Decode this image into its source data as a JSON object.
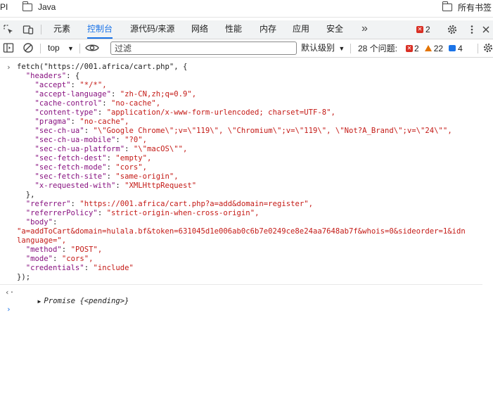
{
  "bookmarks": {
    "left_item": "Java",
    "partial_left": "PI",
    "right_item": "所有书签"
  },
  "tabs": {
    "items": [
      "元素",
      "控制台",
      "源代码/来源",
      "网络",
      "性能",
      "内存",
      "应用",
      "安全"
    ],
    "more": "»",
    "error_count": "2"
  },
  "toolbar": {
    "context": "top",
    "filter_placeholder": "过滤",
    "level": "默认级别",
    "issues_label": "28 个问题:",
    "issue_errors": "2",
    "issue_warnings": "22",
    "issue_info": "4"
  },
  "console": {
    "lines": [
      {
        "type": "call",
        "text": "fetch(\"https://001.africa/cart.php\", {"
      },
      {
        "indent": 1,
        "key": "\"headers\"",
        "rest": ": {"
      },
      {
        "indent": 2,
        "key": "\"accept\"",
        "value": "\"*/*\","
      },
      {
        "indent": 2,
        "key": "\"accept-language\"",
        "value": "\"zh-CN,zh;q=0.9\","
      },
      {
        "indent": 2,
        "key": "\"cache-control\"",
        "value": "\"no-cache\","
      },
      {
        "indent": 2,
        "key": "\"content-type\"",
        "value": "\"application/x-www-form-urlencoded; charset=UTF-8\","
      },
      {
        "indent": 2,
        "key": "\"pragma\"",
        "value": "\"no-cache\","
      },
      {
        "indent": 2,
        "key": "\"sec-ch-ua\"",
        "value": "\"\\\"Google Chrome\\\";v=\\\"119\\\", \\\"Chromium\\\";v=\\\"119\\\", \\\"Not?A_Brand\\\";v=\\\"24\\\"\","
      },
      {
        "indent": 2,
        "key": "\"sec-ch-ua-mobile\"",
        "value": "\"?0\","
      },
      {
        "indent": 2,
        "key": "\"sec-ch-ua-platform\"",
        "value": "\"\\\"macOS\\\"\","
      },
      {
        "indent": 2,
        "key": "\"sec-fetch-dest\"",
        "value": "\"empty\","
      },
      {
        "indent": 2,
        "key": "\"sec-fetch-mode\"",
        "value": "\"cors\","
      },
      {
        "indent": 2,
        "key": "\"sec-fetch-site\"",
        "value": "\"same-origin\","
      },
      {
        "indent": 2,
        "key": "\"x-requested-with\"",
        "value": "\"XMLHttpRequest\""
      },
      {
        "indent": 1,
        "plain": "},"
      },
      {
        "indent": 1,
        "key": "\"referrer\"",
        "value": "\"https://001.africa/cart.php?a=add&domain=register\","
      },
      {
        "indent": 1,
        "key": "\"referrerPolicy\"",
        "value": "\"strict-origin-when-cross-origin\","
      },
      {
        "indent": 1,
        "key": "\"body\"",
        "rest": ":"
      },
      {
        "indent": 0,
        "value": "\"a=addToCart&domain=hulala.bf&token=631045d1e006ab0c6b7e0249ce8e24aa7648ab7f&whois=0&sideorder=1&idn"
      },
      {
        "indent": 0,
        "value": "language=\","
      },
      {
        "indent": 1,
        "key": "\"method\"",
        "value": "\"POST\","
      },
      {
        "indent": 1,
        "key": "\"mode\"",
        "value": "\"cors\","
      },
      {
        "indent": 1,
        "key": "\"credentials\"",
        "value": "\"include\""
      },
      {
        "indent": 0,
        "plain": "});"
      }
    ],
    "result_label": "Promise",
    "result_state": "{<pending>}"
  }
}
